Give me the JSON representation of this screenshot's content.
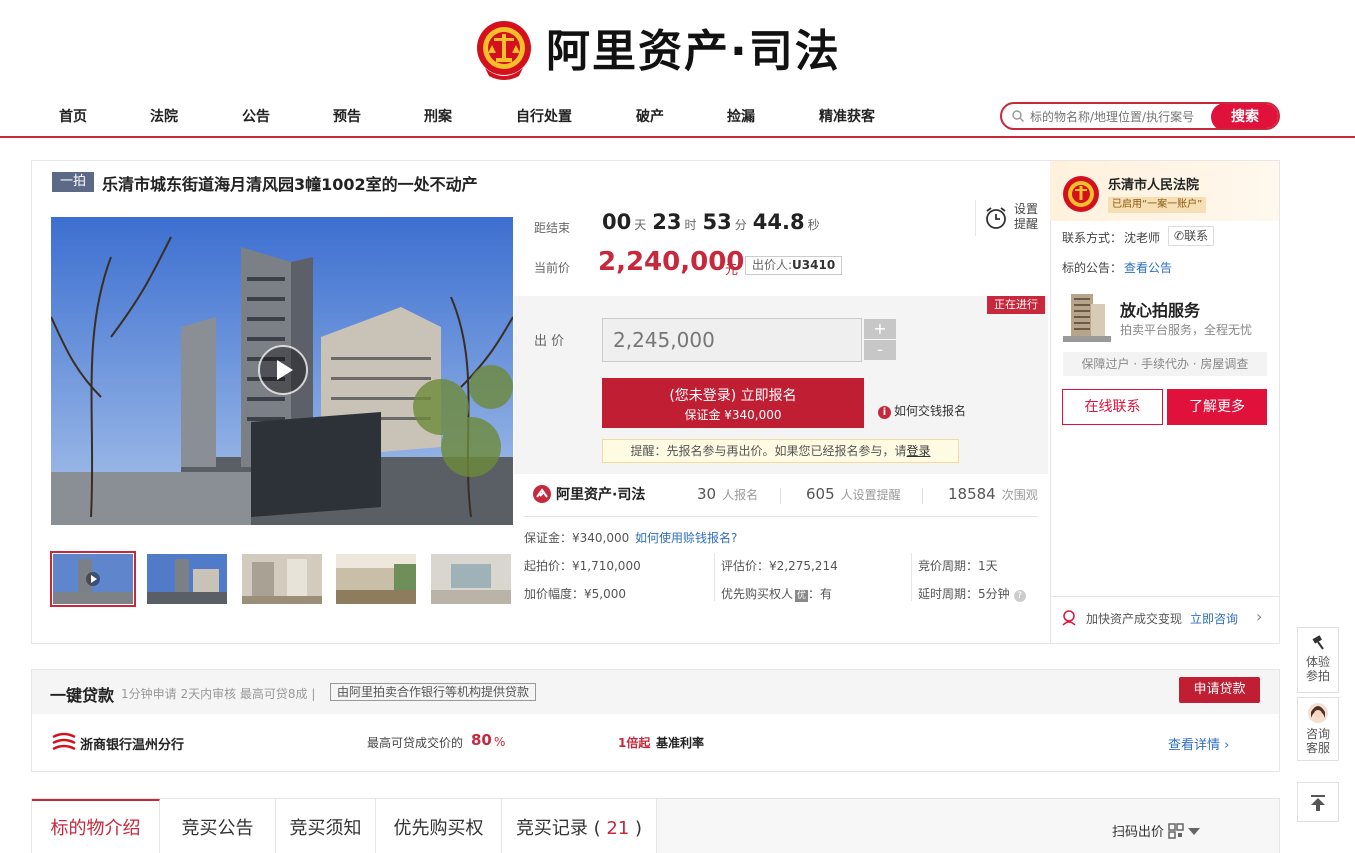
{
  "header": {
    "brand": "阿里资产·司法"
  },
  "nav": [
    "首页",
    "法院",
    "公告",
    "预告",
    "刑案",
    "自行处置",
    "破产",
    "捡漏",
    "精准获客"
  ],
  "search": {
    "placeholder": "标的物名称/地理位置/执行案号",
    "button": "搜索"
  },
  "item": {
    "round_tag": "一拍",
    "title": "乐清市城东街道海月清风园3幢1002室的一处不动产"
  },
  "countdown": {
    "label": "距结束",
    "days": "00",
    "day_unit": "天",
    "hours": "23",
    "hour_unit": "时",
    "minutes": "53",
    "minute_unit": "分",
    "seconds": "44.8",
    "second_unit": "秒"
  },
  "remind": {
    "label": "设置提醒"
  },
  "price": {
    "label": "当前价",
    "value": "2,240,000",
    "unit": "元",
    "bidder_label": "出价人:",
    "bidder": "U3410"
  },
  "bid": {
    "status": "正在进行",
    "label": "出 价",
    "value": "2,245,000",
    "plus": "+",
    "minus": "-",
    "signup_line1": "(您未登录) 立即报名",
    "signup_line2": "保证金 ¥340,000",
    "howto": "如何交钱报名",
    "tip_text": "提醒：先报名参与再出价。如果您已经报名参与，请",
    "tip_link": "登录"
  },
  "stats": {
    "brand": "阿里资产·司法",
    "signups": "30",
    "signups_label": "人报名",
    "reminders": "605",
    "reminders_label": "人设置提醒",
    "views": "18584",
    "views_label": "次围观"
  },
  "details": {
    "deposit": "保证金：¥340,000",
    "deposit_link": "如何使用赊钱报名?",
    "start_price": "起拍价：¥1,710,000",
    "increment": "加价幅度：¥5,000",
    "assessed": "评估价：¥2,275,214",
    "priority": "优先购买权人",
    "priority_badge": "优",
    "priority_value": "：有",
    "period": "竞价周期：1天",
    "extension": "延时周期：5分钟"
  },
  "court": {
    "name": "乐清市人民法院",
    "badge": "已启用“一案一账户”",
    "contact_label": "联系方式：",
    "contact_name": "沈老师",
    "contact_button": "联系",
    "notice_label": "标的公告：",
    "notice_link": "查看公告"
  },
  "service": {
    "title": "放心拍服务",
    "subtitle": "拍卖平台服务，全程无忧",
    "tags": "保障过户 · 手续代办 · 房屋调查",
    "btn_online": "在线联系",
    "btn_more": "了解更多",
    "footer_text": "加快资产成交变现",
    "footer_link": "立即咨询"
  },
  "loan": {
    "title": "一键贷款",
    "subtitle": "1分钟申请 2天内审核 最高可贷8成 |",
    "provider_note": "由阿里拍卖合作银行等机构提供贷款",
    "apply_button": "申请贷款",
    "bank": "浙商银行温州分行",
    "max_label": "最高可贷成交价的",
    "max_value": "80",
    "max_unit": "%",
    "rate_prefix": "1倍起",
    "rate_label": "基准利率",
    "detail_link": "查看详情"
  },
  "tabs": [
    "标的物介绍",
    "竞买公告",
    "竞买须知",
    "优先购买权",
    "竞买记录"
  ],
  "tab_count": "21",
  "scan_bid": "扫码出价",
  "float": {
    "experience": "体验参拍",
    "consult": "咨询客服"
  },
  "colors": {
    "brand_red": "#c8283c",
    "accent_red": "#e0123b",
    "link_blue": "#2f6fc2"
  }
}
